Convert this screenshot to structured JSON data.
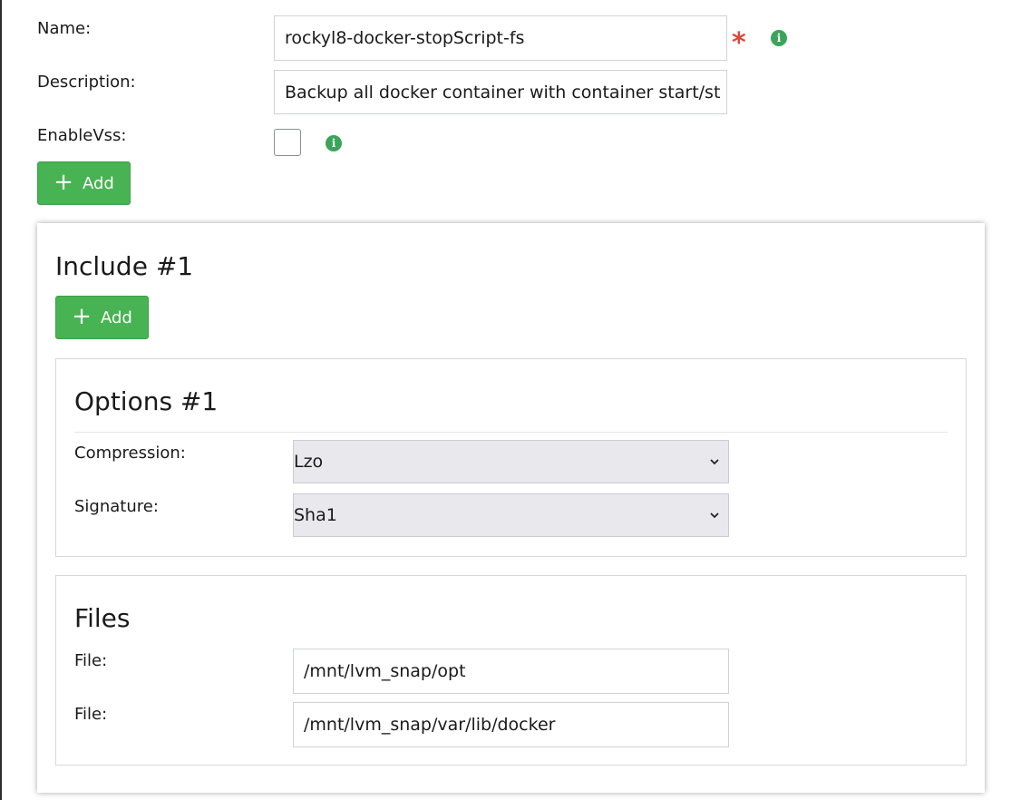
{
  "form": {
    "name_label": "Name:",
    "name_value": "rockyl8-docker-stopScript-fs",
    "required_marker": "*",
    "description_label": "Description:",
    "description_value": "Backup all docker container with container start/st",
    "enablevss_label": "EnableVss:",
    "enablevss_checked": false,
    "info_glyph": "i",
    "add_label": "Add"
  },
  "include": {
    "title": "Include #1",
    "add_label": "Add",
    "options": {
      "title": "Options #1",
      "compression_label": "Compression:",
      "compression_value": "Lzo",
      "signature_label": "Signature:",
      "signature_value": "Sha1"
    },
    "files": {
      "title": "Files",
      "items": [
        {
          "label": "File:",
          "value": "/mnt/lvm_snap/opt"
        },
        {
          "label": "File:",
          "value": "/mnt/lvm_snap/var/lib/docker"
        }
      ]
    }
  },
  "colors": {
    "accent_green": "#47b352",
    "required_red": "#e0463a",
    "info_green": "#3aa55a"
  },
  "icons": {
    "plus": "plus-icon",
    "info": "info-icon",
    "chevron": "chevron-down-icon"
  }
}
